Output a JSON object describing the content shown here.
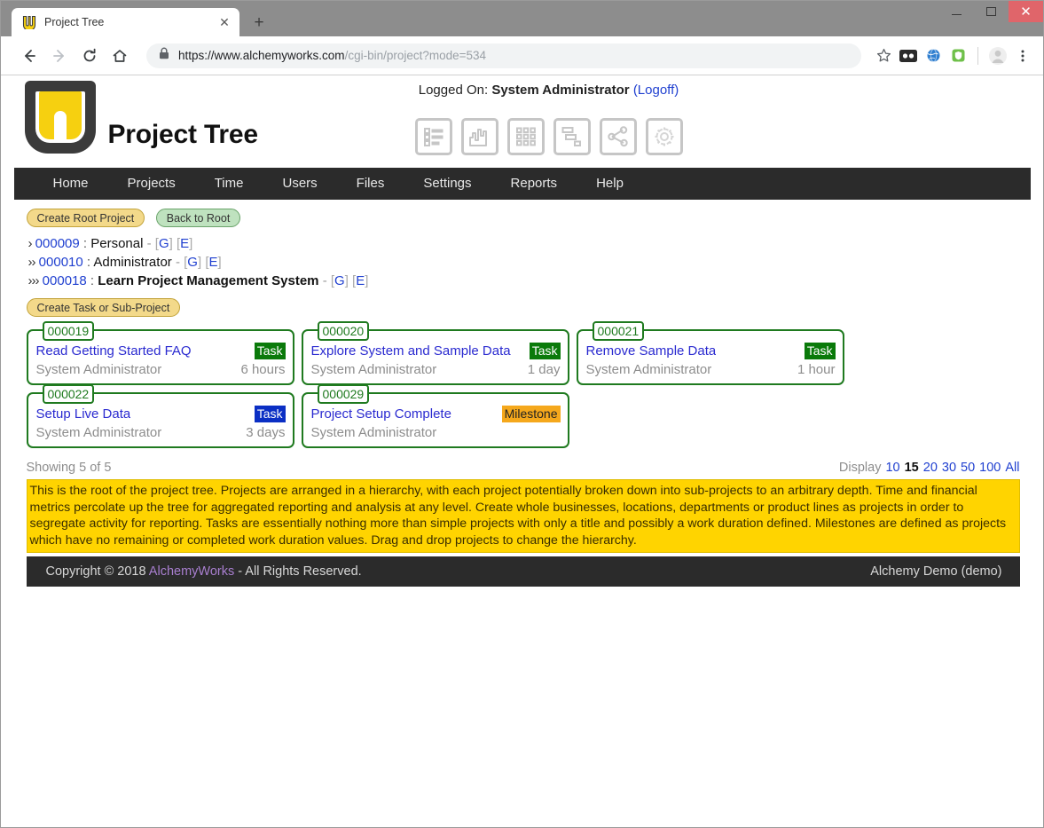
{
  "browser": {
    "tab_title": "Project Tree",
    "tab_favicon": "project-tree-logo-icon",
    "close_tab_glyph": "✕",
    "new_tab_glyph": "+",
    "back_glyph": "←",
    "forward_glyph": "→",
    "reload_glyph": "⟳",
    "home_glyph": "⌂",
    "lock_glyph": "🔒",
    "url_prefix": "https://www.alchemyworks.com",
    "url_suffix": "/cgi-bin/project?mode=534",
    "bookmark_glyph": "☆",
    "extension_icons": [
      "extension-dots-icon",
      "globe-icon",
      "shield-icon"
    ],
    "profile_glyph": "●",
    "menu_glyph": "⋮",
    "window_minimize": "—",
    "window_maximize": "▢",
    "window_close": "✕"
  },
  "header": {
    "app_title": "Project Tree",
    "logged_on_label": "Logged On:",
    "user_name": "System Administrator",
    "logoff_label": "(Logoff)",
    "icons": [
      {
        "name": "list-view-icon"
      },
      {
        "name": "gantt-chart-icon"
      },
      {
        "name": "grid-view-icon"
      },
      {
        "name": "hierarchy-view-icon"
      },
      {
        "name": "network-view-icon"
      },
      {
        "name": "settings-gear-icon"
      }
    ]
  },
  "nav": {
    "items": [
      {
        "label": "Home"
      },
      {
        "label": "Projects"
      },
      {
        "label": "Time"
      },
      {
        "label": "Users"
      },
      {
        "label": "Files"
      },
      {
        "label": "Settings"
      },
      {
        "label": "Reports"
      },
      {
        "label": "Help"
      }
    ]
  },
  "toolbar": {
    "create_root_project": "Create Root Project",
    "back_to_root": "Back to Root",
    "create_task_or_subproject": "Create Task or Sub-Project"
  },
  "tree": {
    "rows": [
      {
        "chevrons": "›",
        "id": "000009",
        "separator": ":",
        "name": "Personal",
        "dash": "-",
        "link_g": "[G]",
        "link_e": "[E]",
        "current": false
      },
      {
        "chevrons": "››",
        "id": "000010",
        "separator": ":",
        "name": "Administrator",
        "dash": "-",
        "link_g": "[G]",
        "link_e": "[E]",
        "current": false
      },
      {
        "chevrons": "›››",
        "id": "000018",
        "separator": ":",
        "name": "Learn Project Management System",
        "dash": "-",
        "link_g": "[G]",
        "link_e": "[E]",
        "current": true
      }
    ]
  },
  "cards": [
    {
      "id": "000019",
      "title": "Read Getting Started FAQ",
      "badge": "Task",
      "badge_style": "task-green",
      "owner": "System Administrator",
      "duration": "6 hours"
    },
    {
      "id": "000020",
      "title": "Explore System and Sample Data",
      "badge": "Task",
      "badge_style": "task-green",
      "owner": "System Administrator",
      "duration": "1 day"
    },
    {
      "id": "000021",
      "title": "Remove Sample Data",
      "badge": "Task",
      "badge_style": "task-green",
      "owner": "System Administrator",
      "duration": "1 hour"
    },
    {
      "id": "000022",
      "title": "Setup Live Data",
      "badge": "Task",
      "badge_style": "task-blue",
      "owner": "System Administrator",
      "duration": "3 days"
    },
    {
      "id": "000029",
      "title": "Project Setup Complete",
      "badge": "Milestone",
      "badge_style": "milestone",
      "owner": "System Administrator",
      "duration": ""
    }
  ],
  "paging": {
    "showing_text": "Showing 5 of 5",
    "display_label": "Display",
    "options": [
      "10",
      "15",
      "20",
      "30",
      "50",
      "100",
      "All"
    ],
    "active_option": "15"
  },
  "help": {
    "text": "This is the root of the project tree. Projects are arranged in a hierarchy, with each project potentially broken down into sub-projects to an arbitrary depth. Time and financial metrics percolate up the tree for aggregated reporting and analysis at any level. Create whole businesses, locations, departments or product lines as projects in order to segregate activity for reporting. Tasks are essentially nothing more than simple projects with only a title and possibly a work duration defined. Milestones are defined as projects which have no remaining or completed work duration values. Drag and drop projects to change the hierarchy."
  },
  "footer": {
    "copyright_prefix": "Copyright © 2018",
    "brand": "AlchemyWorks",
    "copyright_suffix": "- All Rights Reserved.",
    "account": "Alchemy Demo (demo)"
  },
  "colors": {
    "accent_yellow": "#f6d010",
    "nav_dark": "#2b2b2b",
    "card_green": "#1f7a1f",
    "link_blue": "#2040d0",
    "badge_task_green": "#0a7a0a",
    "badge_task_blue": "#0b2fc4",
    "badge_milestone": "#f5a81c",
    "help_yellow": "#ffd400"
  }
}
